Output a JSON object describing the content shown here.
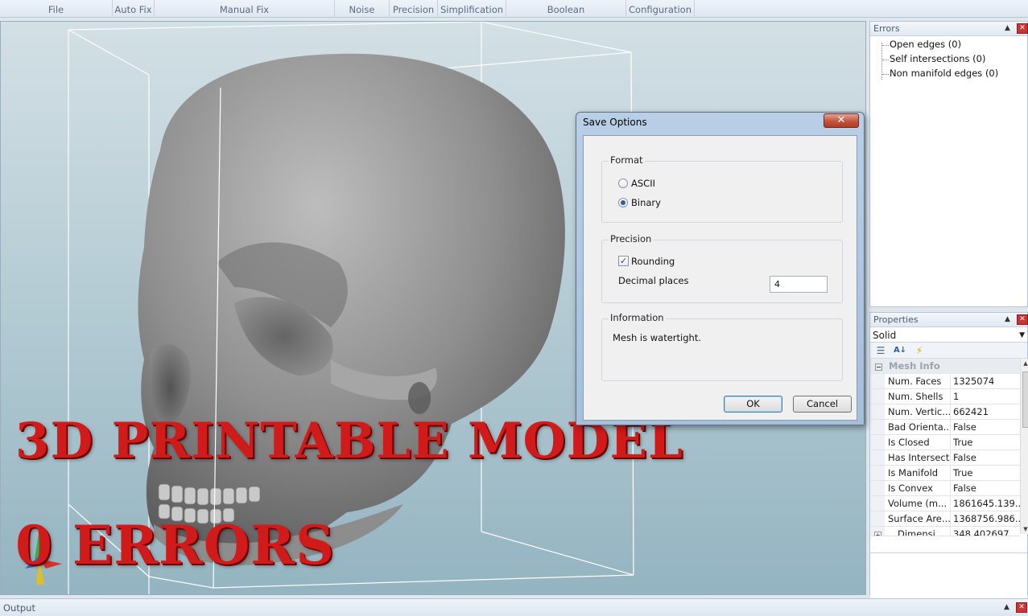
{
  "ribbon": {
    "tabs": [
      "File",
      "Auto Fix",
      "Manual Fix",
      "Noise Shells",
      "Precision",
      "Simplification",
      "Boolean",
      "Configuration"
    ]
  },
  "viewport": {
    "promo_line1": "3D PRINTABLE MODEL",
    "promo_line2": "0 ERRORS"
  },
  "errors_panel": {
    "title": "Errors",
    "items": [
      "Open edges (0)",
      "Self intersections (0)",
      "Non manifold edges (0)"
    ]
  },
  "properties_panel": {
    "title": "Properties",
    "selected": "Solid",
    "category": "Mesh Info",
    "rows": [
      {
        "name": "Num. Faces",
        "value": "1325074"
      },
      {
        "name": "Num. Shells",
        "value": "1"
      },
      {
        "name": "Num. Vertic...",
        "value": "662421"
      },
      {
        "name": "Bad Orienta...",
        "value": "False"
      },
      {
        "name": "Is Closed",
        "value": "True"
      },
      {
        "name": "Has Intersects",
        "value": "False"
      },
      {
        "name": "Is Manifold",
        "value": "True"
      },
      {
        "name": "Is Convex",
        "value": "False"
      },
      {
        "name": "Volume (m...",
        "value": "1861645.139..."
      },
      {
        "name": "Surface Are...",
        "value": "1368756.986..."
      },
      {
        "name": "Dimensi...",
        "value": "348.402697..."
      }
    ]
  },
  "output_panel": {
    "title": "Output"
  },
  "dialog": {
    "title": "Save Options",
    "format_label": "Format",
    "format_options": [
      "ASCII",
      "Binary"
    ],
    "format_selected": "Binary",
    "precision_label": "Precision",
    "rounding_label": "Rounding",
    "rounding_checked": true,
    "decimal_label": "Decimal places",
    "decimal_value": "4",
    "info_label": "Information",
    "info_text": "Mesh is watertight.",
    "ok_label": "OK",
    "cancel_label": "Cancel"
  },
  "colors": {
    "promo_text": "#d11a1a",
    "viewport_top": "#d3e0e5",
    "viewport_bottom": "#94b4c1",
    "accent": "#2a5fa0"
  }
}
